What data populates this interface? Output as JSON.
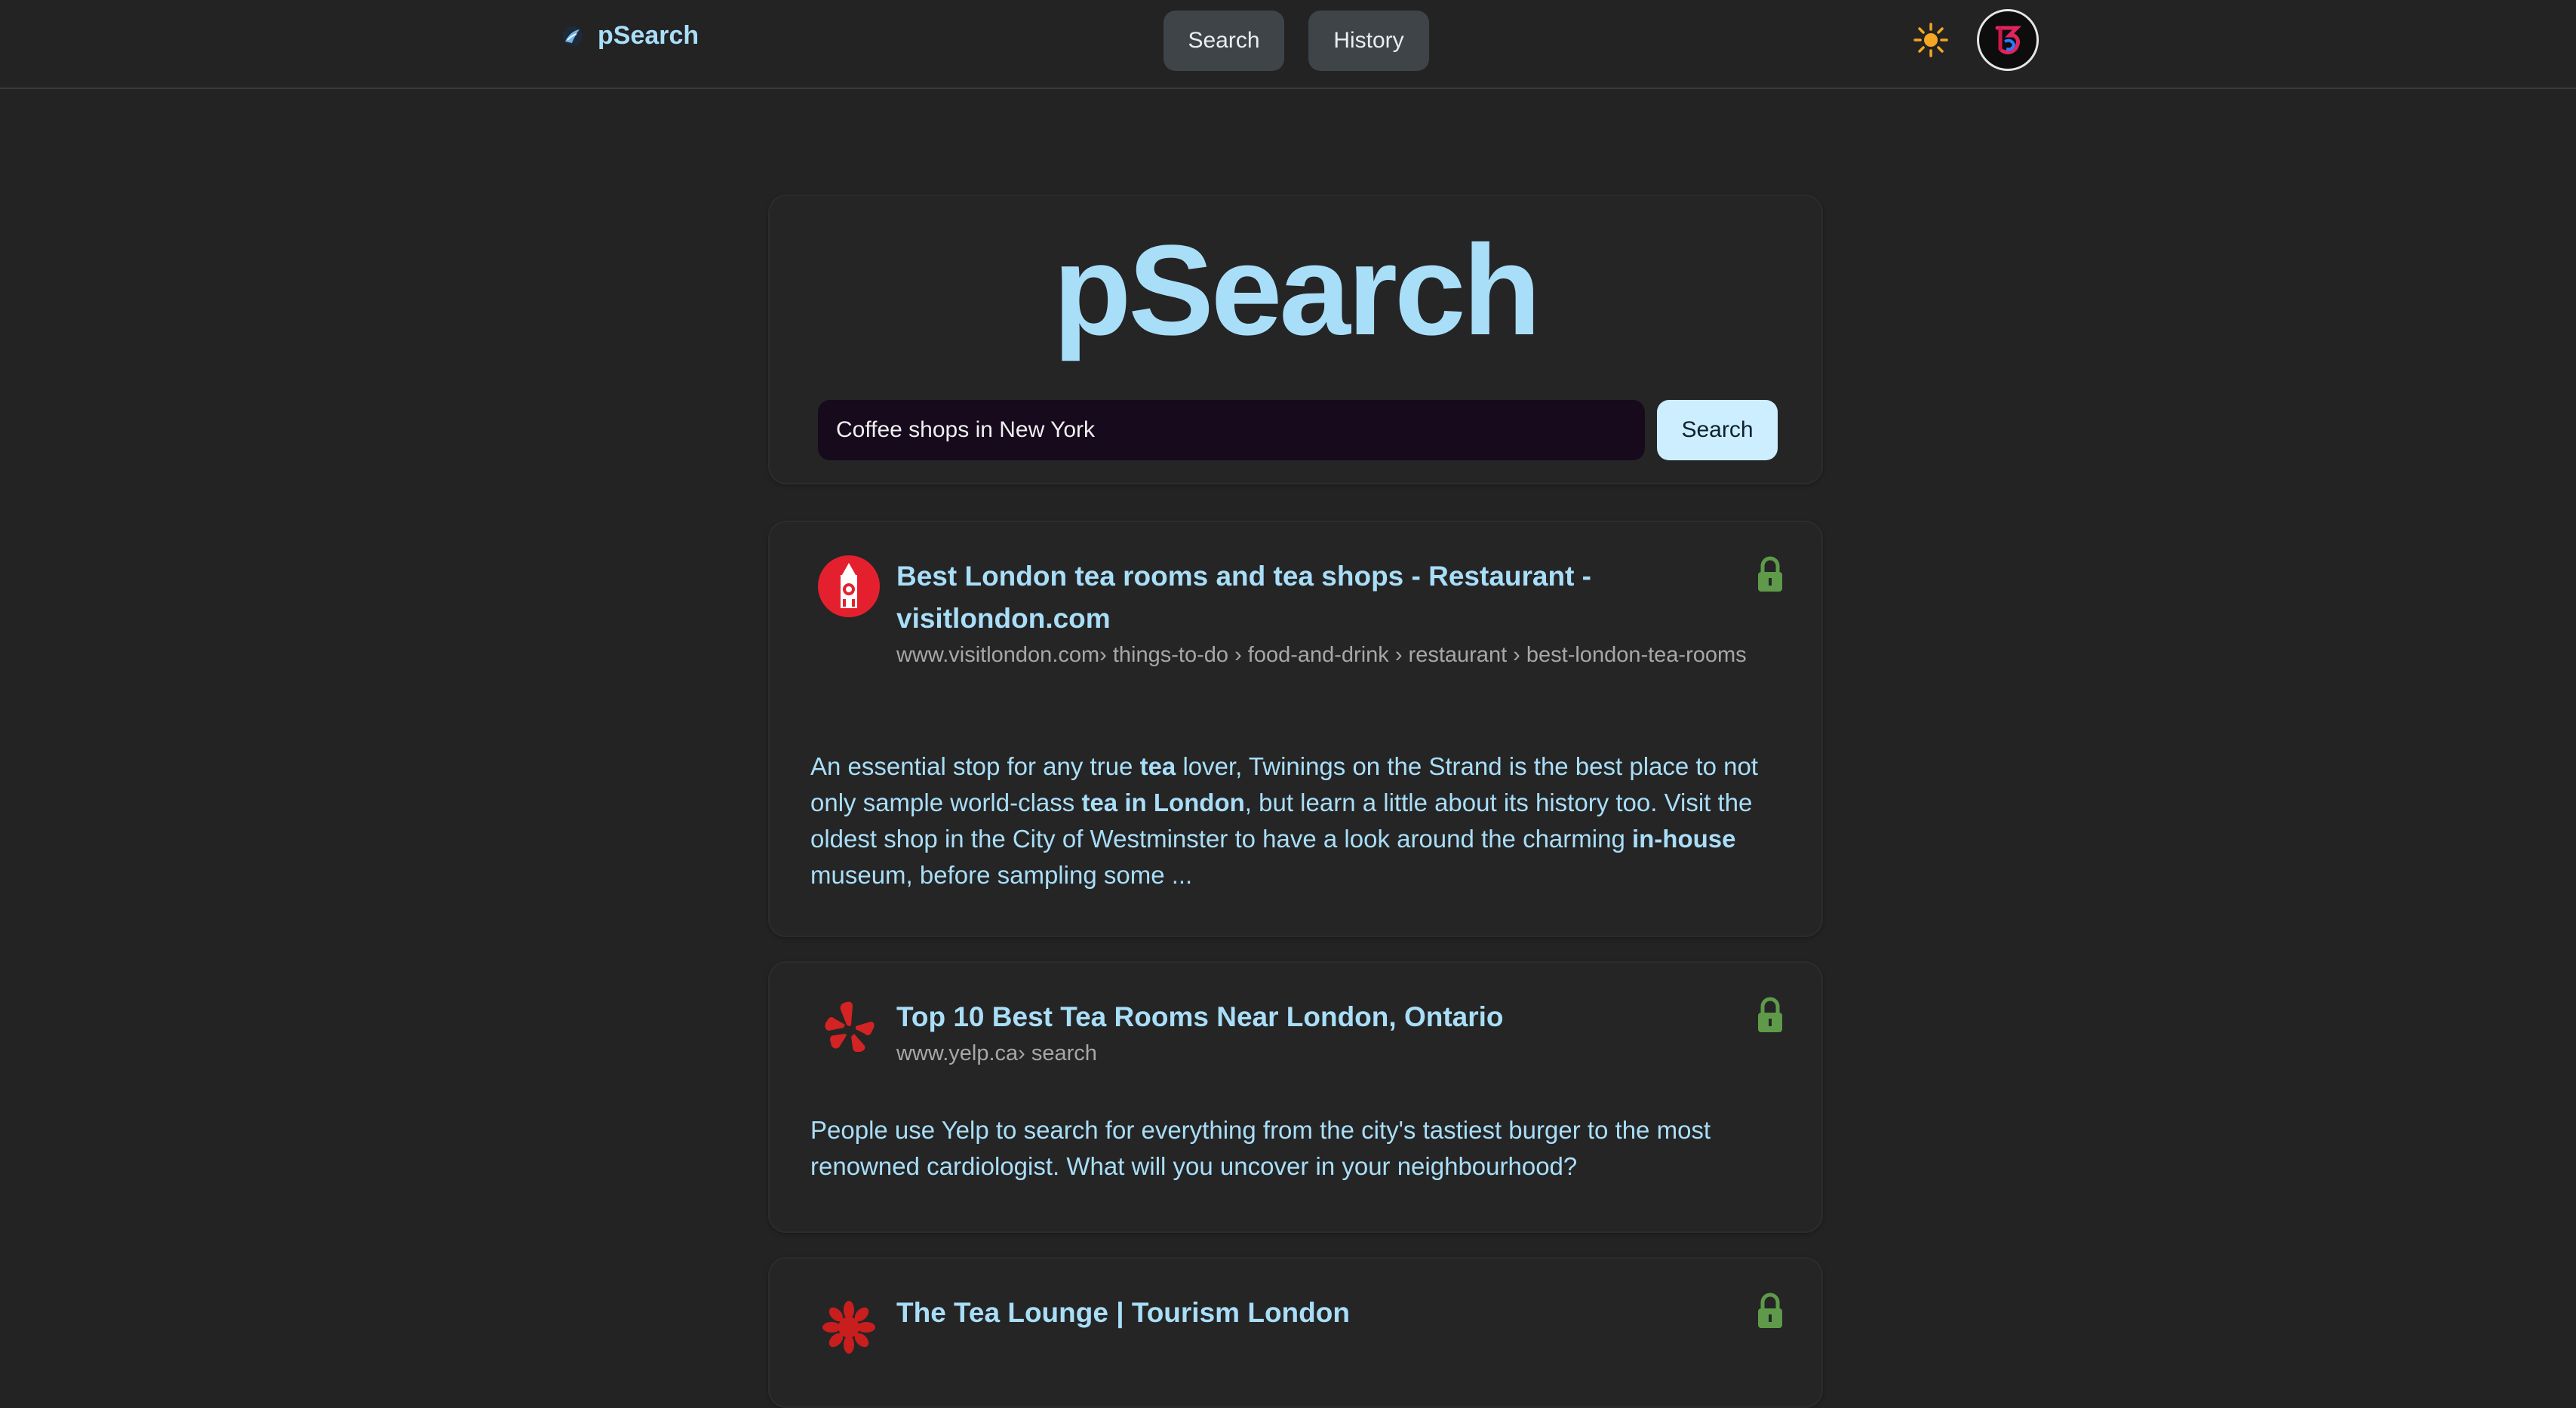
{
  "header": {
    "brand": "pSearch",
    "nav": [
      {
        "label": "Search"
      },
      {
        "label": "History"
      }
    ],
    "theme_icon": "sun-icon",
    "avatar_icon": "user-avatar"
  },
  "hero": {
    "title": "pSearch",
    "query_value": "Coffee shops in New York",
    "button_label": "Search"
  },
  "results": [
    {
      "icon": "big-ben-icon",
      "title": "Best London tea rooms and tea shops - Restaurant - visitlondon.com",
      "url": "www.visitlondon.com› things-to-do › food-and-drink › restaurant › best-london-tea-rooms",
      "snippet_parts": [
        {
          "text": "An essential stop for any true ",
          "bold": false
        },
        {
          "text": "tea",
          "bold": true
        },
        {
          "text": " lover, Twinings on the Strand is the best place to not only sample world-class ",
          "bold": false
        },
        {
          "text": "tea in London",
          "bold": true
        },
        {
          "text": ", but learn a little about its history too. Visit the oldest shop in the City of Westminster to have a look around the charming ",
          "bold": false
        },
        {
          "text": "in-house",
          "bold": true
        },
        {
          "text": " museum, before sampling some ...",
          "bold": false
        }
      ],
      "secure": true
    },
    {
      "icon": "yelp-icon",
      "title": "Top 10 Best Tea Rooms Near London, Ontario",
      "url": "www.yelp.ca› search",
      "snippet_parts": [
        {
          "text": "People use Yelp to search for everything from the city's tastiest burger to the most renowned cardiologist. What will you uncover in your neighbourhood?",
          "bold": false
        }
      ],
      "secure": true
    },
    {
      "icon": "tourism-london-icon",
      "title": "The Tea Lounge | Tourism London",
      "url": "",
      "snippet_parts": [],
      "secure": true
    }
  ],
  "colors": {
    "background": "#232323",
    "accent": "#a9def9",
    "lock": "#5f9a4a"
  }
}
